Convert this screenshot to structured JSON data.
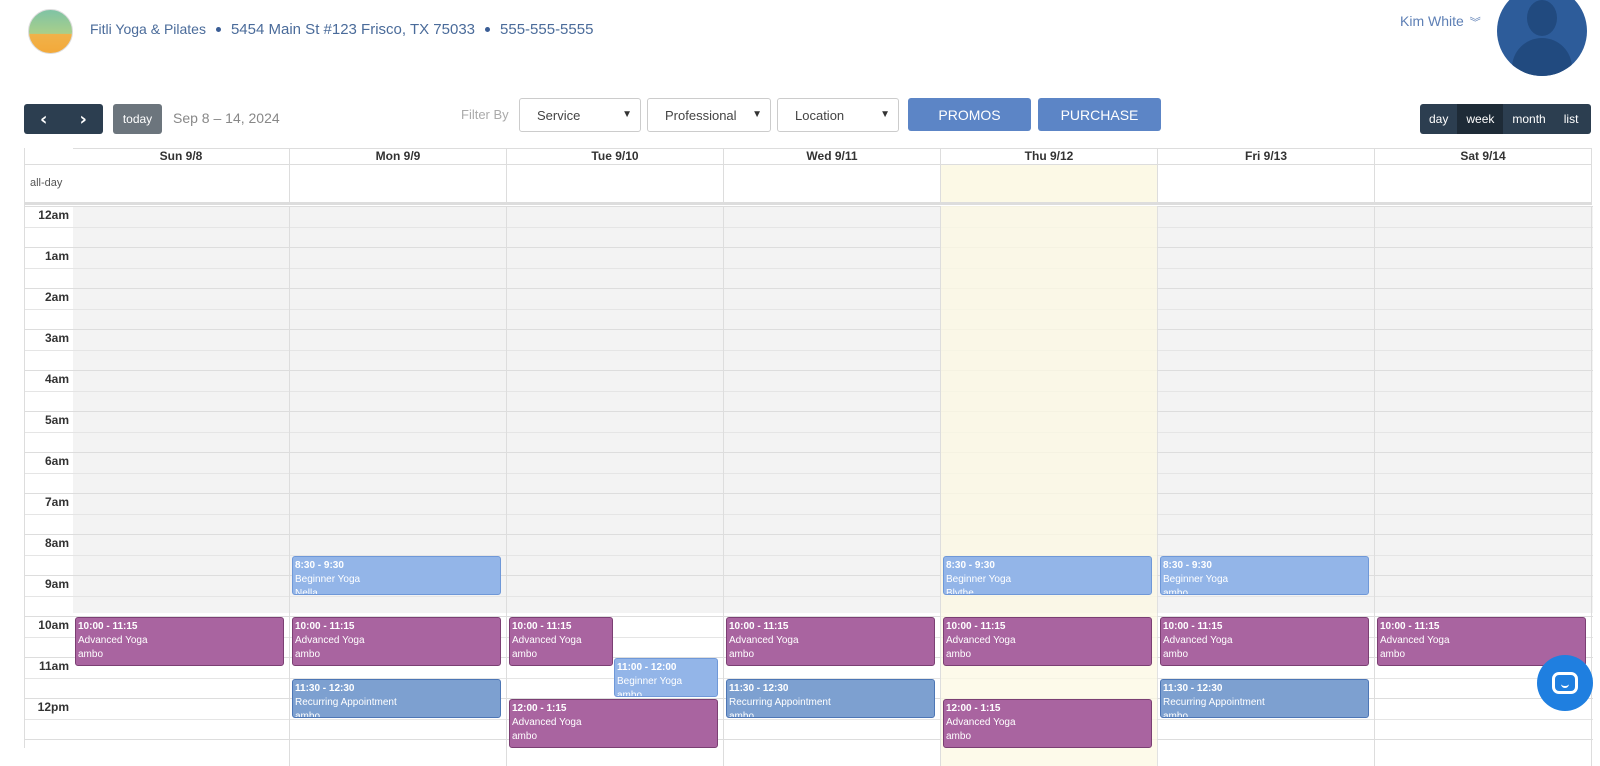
{
  "header": {
    "studio": "Fitli Yoga & Pilates",
    "address": "5454 Main St #123 Frisco, TX 75033",
    "phone": "555-555-5555",
    "user_name": "Kim White"
  },
  "toolbar": {
    "prev_icon": "chevron-left-icon",
    "next_icon": "chevron-right-icon",
    "today_label": "today",
    "date_range": "Sep 8 – 14, 2024",
    "filter_by": "Filter By",
    "service": "Service",
    "professional": "Professional",
    "location": "Location",
    "promos": "PROMOS",
    "purchase": "PURCHASE",
    "views": [
      "day",
      "week",
      "month",
      "list"
    ],
    "active_view": "week"
  },
  "calendar": {
    "allday_label": "all-day",
    "days": [
      "Sun 9/8",
      "Mon 9/9",
      "Tue 9/10",
      "Wed 9/11",
      "Thu 9/12",
      "Fri 9/13",
      "Sat 9/14"
    ],
    "today_index": 4,
    "hours": [
      "12am",
      "1am",
      "2am",
      "3am",
      "4am",
      "5am",
      "6am",
      "7am",
      "8am",
      "9am",
      "10am",
      "11am",
      "12pm"
    ],
    "events": [
      {
        "day": 1,
        "start": 8.5,
        "end": 9.5,
        "time": "8:30 - 9:30",
        "title": "Beginner Yoga",
        "who": "Nella",
        "color": "lblue"
      },
      {
        "day": 4,
        "start": 8.5,
        "end": 9.5,
        "time": "8:30 - 9:30",
        "title": "Beginner Yoga",
        "who": "Blythe",
        "color": "lblue"
      },
      {
        "day": 5,
        "start": 8.5,
        "end": 9.5,
        "time": "8:30 - 9:30",
        "title": "Beginner Yoga",
        "who": "ambo",
        "color": "lblue"
      },
      {
        "day": 0,
        "start": 10,
        "end": 11.25,
        "time": "10:00 - 11:15",
        "title": "Advanced Yoga",
        "who": "ambo",
        "color": "purple"
      },
      {
        "day": 1,
        "start": 10,
        "end": 11.25,
        "time": "10:00 - 11:15",
        "title": "Advanced Yoga",
        "who": "ambo",
        "color": "purple"
      },
      {
        "day": 2,
        "start": 10,
        "end": 11.25,
        "time": "10:00 - 11:15",
        "title": "Advanced Yoga",
        "who": "ambo",
        "color": "purple",
        "half": "left"
      },
      {
        "day": 3,
        "start": 10,
        "end": 11.25,
        "time": "10:00 - 11:15",
        "title": "Advanced Yoga",
        "who": "ambo",
        "color": "purple"
      },
      {
        "day": 4,
        "start": 10,
        "end": 11.25,
        "time": "10:00 - 11:15",
        "title": "Advanced Yoga",
        "who": "ambo",
        "color": "purple"
      },
      {
        "day": 5,
        "start": 10,
        "end": 11.25,
        "time": "10:00 - 11:15",
        "title": "Advanced Yoga",
        "who": "ambo",
        "color": "purple"
      },
      {
        "day": 6,
        "start": 10,
        "end": 11.25,
        "time": "10:00 - 11:15",
        "title": "Advanced Yoga",
        "who": "ambo",
        "color": "purple"
      },
      {
        "day": 2,
        "start": 11,
        "end": 12,
        "time": "11:00 - 12:00",
        "title": "Beginner Yoga",
        "who": "ambo",
        "color": "lblue",
        "half": "right"
      },
      {
        "day": 1,
        "start": 11.5,
        "end": 12.5,
        "time": "11:30 - 12:30",
        "title": "Recurring Appointment",
        "who": "ambo",
        "color": "blue"
      },
      {
        "day": 3,
        "start": 11.5,
        "end": 12.5,
        "time": "11:30 - 12:30",
        "title": "Recurring Appointment",
        "who": "ambo",
        "color": "blue"
      },
      {
        "day": 5,
        "start": 11.5,
        "end": 12.5,
        "time": "11:30 - 12:30",
        "title": "Recurring Appointment",
        "who": "ambo",
        "color": "blue"
      },
      {
        "day": 2,
        "start": 12,
        "end": 13.25,
        "time": "12:00 - 1:15",
        "title": "Advanced Yoga",
        "who": "ambo",
        "color": "purple"
      },
      {
        "day": 4,
        "start": 12,
        "end": 13.25,
        "time": "12:00 - 1:15",
        "title": "Advanced Yoga",
        "who": "ambo",
        "color": "purple"
      }
    ]
  },
  "chat_icon": "chat-bubble-icon"
}
